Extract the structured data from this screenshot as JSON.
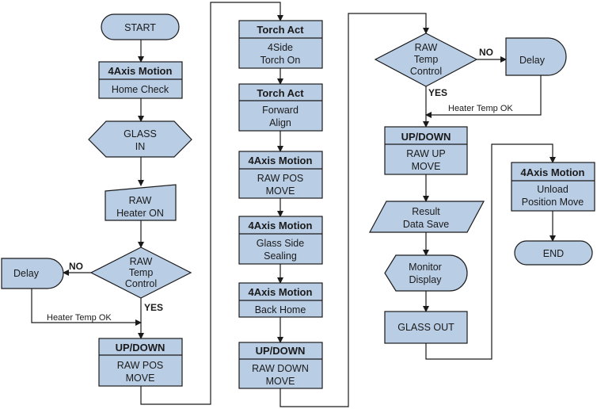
{
  "colors": {
    "node_fill": "#b9cde5",
    "stroke": "#1a1a1a"
  },
  "col1": {
    "start": "START",
    "home": {
      "header": "4Axis Motion",
      "body": "Home Check"
    },
    "glass_in": [
      "GLASS",
      "IN"
    ],
    "heater": [
      "RAW",
      "Heater ON"
    ],
    "decision": [
      "RAW",
      "Temp",
      "Control"
    ],
    "no": "NO",
    "yes": "YES",
    "delay": "Delay",
    "heater_ok": "Heater Temp OK",
    "updown": {
      "header": "UP/DOWN",
      "body": [
        "RAW POS",
        "MOVE"
      ]
    }
  },
  "col2": {
    "torch1": {
      "header": "Torch Act",
      "body": [
        "4Side",
        "Torch On"
      ]
    },
    "torch2": {
      "header": "Torch Act",
      "body": [
        "Forward",
        "Align"
      ]
    },
    "raw_pos": {
      "header": "4Axis Motion",
      "body": [
        "RAW POS",
        "MOVE"
      ]
    },
    "sealing": {
      "header": "4Axis Motion",
      "body": [
        "Glass Side",
        "Sealing"
      ]
    },
    "back_home": {
      "header": "4Axis Motion",
      "body": "Back Home"
    },
    "raw_down": {
      "header": "UP/DOWN",
      "body": [
        "RAW DOWN",
        "MOVE"
      ]
    }
  },
  "col3": {
    "decision": [
      "RAW",
      "Temp",
      "Control"
    ],
    "no": "NO",
    "yes": "YES",
    "delay": "Delay",
    "heater_ok": "Heater Temp OK",
    "raw_up": {
      "header": "UP/DOWN",
      "body": [
        "RAW UP",
        "MOVE"
      ]
    },
    "result": [
      "Result",
      "Data Save"
    ],
    "monitor": [
      "Monitor",
      "Display"
    ],
    "glass_out": "GLASS OUT"
  },
  "col4": {
    "unload": {
      "header": "4Axis Motion",
      "body": [
        "Unload",
        "Position Move"
      ]
    },
    "end": "END"
  }
}
